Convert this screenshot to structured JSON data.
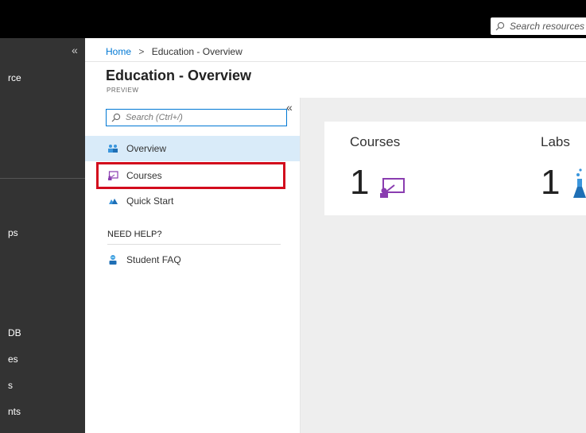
{
  "topbar": {
    "search_placeholder": "Search resources"
  },
  "leftnav": {
    "collapse": "«",
    "items": [
      "rce",
      "ps",
      "DB",
      "es",
      "s",
      "nts"
    ]
  },
  "breadcrumb": {
    "home": "Home",
    "separator": ">",
    "current": "Education - Overview"
  },
  "page": {
    "title": "Education - Overview",
    "subtitle": "PREVIEW"
  },
  "menu": {
    "search_placeholder": "Search (Ctrl+/)",
    "collapse": "«",
    "items": [
      {
        "label": "Overview",
        "icon": "people-icon",
        "active": true
      },
      {
        "label": "Courses",
        "icon": "classroom-icon",
        "highlighted": true
      },
      {
        "label": "Quick Start",
        "icon": "cloud-icon"
      }
    ],
    "help_heading": "NEED HELP?",
    "help_items": [
      {
        "label": "Student FAQ",
        "icon": "student-icon"
      }
    ]
  },
  "cards": [
    {
      "label": "Courses",
      "count": "1",
      "icon": "classroom-icon"
    },
    {
      "label": "Labs",
      "count": "1",
      "icon": "flask-icon"
    }
  ],
  "colors": {
    "accent": "#0078d4",
    "highlight": "#d20c1d",
    "course_icon": "#8a3db0"
  }
}
